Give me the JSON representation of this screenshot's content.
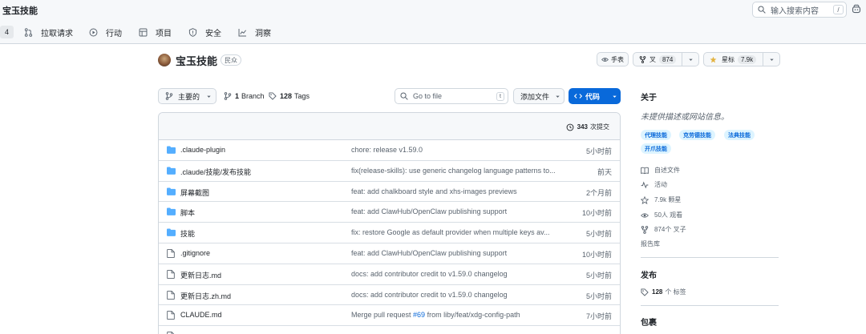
{
  "header": {
    "title": "宝玉技能",
    "search_placeholder": "输入搜索内容",
    "search_key": "/"
  },
  "repo_nav": {
    "counter": "4",
    "items": [
      {
        "label": "拉取请求",
        "icon": "pull-request-icon"
      },
      {
        "label": "行动",
        "icon": "play-icon"
      },
      {
        "label": "项目",
        "icon": "table-icon"
      },
      {
        "label": "安全",
        "icon": "shield-icon"
      },
      {
        "label": "洞察",
        "icon": "graph-icon"
      }
    ]
  },
  "repo": {
    "name": "宝玉技能",
    "visibility": "民众",
    "watch_label": "手表",
    "fork_label": "叉",
    "fork_count": "874",
    "star_label": "星标",
    "star_count": "7.9k"
  },
  "branch_bar": {
    "branch_label": "主要的",
    "branches_count": "1",
    "branches_label": "Branch",
    "tags_count": "128",
    "tags_label": "Tags",
    "goto_placeholder": "Go to file",
    "goto_key": "t",
    "add_file_label": "添加文件",
    "code_label": "代码"
  },
  "files": {
    "commits_count": "343",
    "commits_label": "次提交",
    "rows": [
      {
        "type": "folder",
        "name": ".claude-plugin",
        "message": "chore: release v1.59.0",
        "time": "5小时前"
      },
      {
        "type": "folder",
        "name": ".claude/技能/发布技能",
        "message": "fix(release-skills): use generic changelog language patterns to...",
        "time": "前天"
      },
      {
        "type": "folder",
        "name": "屏幕截图",
        "message": "feat: add chalkboard style and xhs-images previews",
        "time": "2个月前"
      },
      {
        "type": "folder",
        "name": "脚本",
        "message": "feat: add ClawHub/OpenClaw publishing support",
        "time": "10小时前"
      },
      {
        "type": "folder",
        "name": "技能",
        "message": "fix: restore Google as default provider when multiple keys av...",
        "time": "5小时前"
      },
      {
        "type": "file",
        "name": ".gitignore",
        "message": "feat: add ClawHub/OpenClaw publishing support",
        "time": "10小时前"
      },
      {
        "type": "file",
        "name": "更新日志.md",
        "message": "docs: add contributor credit to v1.59.0 changelog",
        "time": "5小时前"
      },
      {
        "type": "file",
        "name": "更新日志.zh.md",
        "message": "docs: add contributor credit to v1.59.0 changelog",
        "time": "5小时前"
      },
      {
        "type": "file",
        "name": "CLAUDE.md",
        "message_prefix": "Merge pull request ",
        "message_link": "#69",
        "message_suffix": " from liby/feat/xdg-config-path",
        "time": "7小时前"
      },
      {
        "type": "file",
        "name": "",
        "message": "",
        "time": ""
      }
    ]
  },
  "sidebar": {
    "about_title": "关于",
    "about_desc": "未提供描述或网站信息。",
    "topics": [
      "代理技能",
      "克劳德技能",
      "法典技能",
      "开爪技能"
    ],
    "items": [
      {
        "icon": "book-icon",
        "label": "自述文件"
      },
      {
        "icon": "activity-icon",
        "label": "活动"
      },
      {
        "icon": "star-icon",
        "label": "7.9k 颗星"
      },
      {
        "icon": "eye-icon",
        "label": "50人 观看"
      },
      {
        "icon": "fork-icon",
        "label": "874个 叉子"
      }
    ],
    "report_label": "报告库",
    "releases_title": "发布",
    "tags_count": "128",
    "tags_label": "个 标签",
    "packages_title": "包裹"
  },
  "colors": {
    "accent": "#0969da",
    "folder": "#54aeff",
    "star": "#e3b341"
  }
}
